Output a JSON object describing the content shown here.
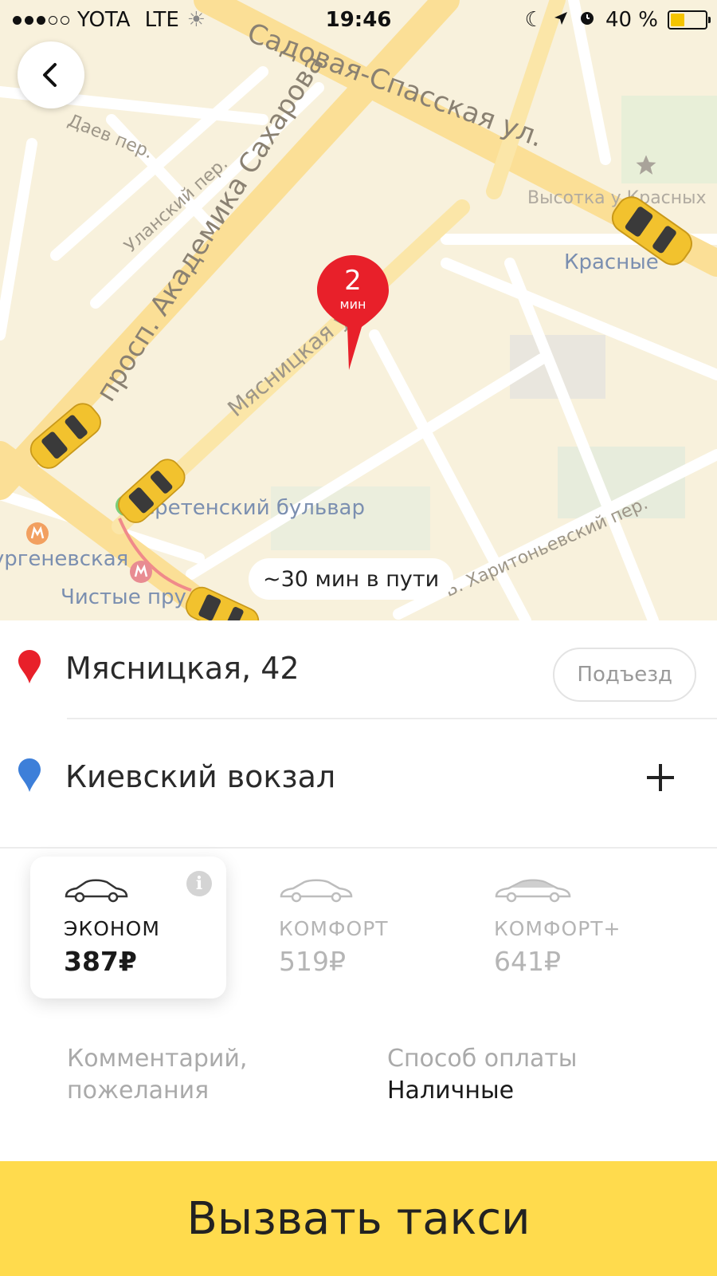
{
  "status_bar": {
    "carrier": "YOTA",
    "network": "LTE",
    "time": "19:46",
    "battery": "40 %",
    "battery_level": 0.4,
    "signal_bars": 3,
    "signal_total": 5
  },
  "map": {
    "labels": {
      "sadovaya": "Садовая-Спасская ул.",
      "sakharova": "просп. Академика Сахарова",
      "myasnitskaya": "Мясницкая ул.",
      "daev": "Даев пер.",
      "ulansky": "Уланский пер.",
      "vysotka": "Высотка у Красных",
      "krasnye": "Красные",
      "sretensky": "Сретенский бульвар",
      "turgenevskaya": "Тургеневская",
      "chistye": "Чистые пру",
      "kharitonyevsky": "Б. Харитоньевский пер."
    },
    "pin": {
      "number": "2",
      "unit": "мин"
    },
    "travel_time": "~30 мин в пути"
  },
  "route": {
    "from": "Мясницкая, 42",
    "entrance_label": "Подъезд",
    "to": "Киевский вокзал"
  },
  "tariffs": [
    {
      "name": "ЭКОНОМ",
      "price": "387₽",
      "selected": true
    },
    {
      "name": "КОМФОРТ",
      "price": "519₽",
      "selected": false
    },
    {
      "name": "КОМФОРТ+",
      "price": "641₽",
      "selected": false
    }
  ],
  "options": {
    "comment_label_line1": "Комментарий,",
    "comment_label_line2": "пожелания",
    "payment_label": "Способ оплаты",
    "payment_value": "Наличные"
  },
  "call_button": "Вызвать такси",
  "colors": {
    "accent_yellow": "#ffdb4d",
    "pin_red": "#e8202a",
    "pin_blue": "#3d7fd9",
    "map_background": "#f8f1dc"
  }
}
